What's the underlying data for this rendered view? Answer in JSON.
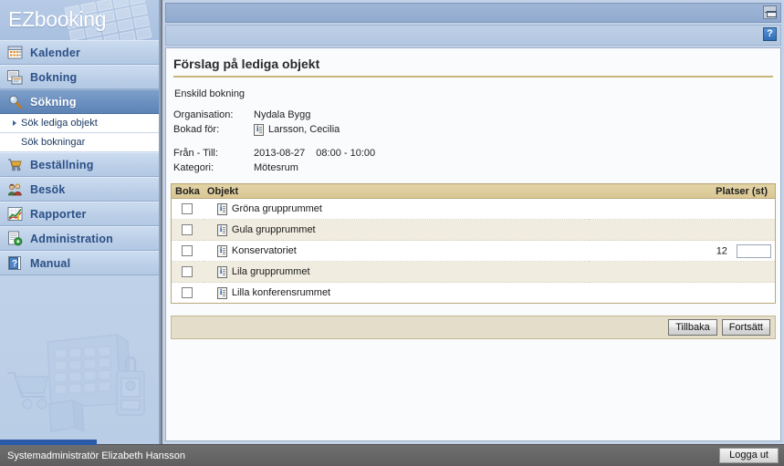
{
  "app": {
    "logo_text": "EZbooking"
  },
  "sidebar": {
    "items": [
      {
        "label": "Kalender",
        "icon": "calendar-icon",
        "selected": false
      },
      {
        "label": "Bokning",
        "icon": "booking-icon",
        "selected": false
      },
      {
        "label": "Sökning",
        "icon": "search-icon",
        "selected": true
      },
      {
        "label": "Beställning",
        "icon": "cart-icon",
        "selected": false
      },
      {
        "label": "Besök",
        "icon": "visitors-icon",
        "selected": false
      },
      {
        "label": "Rapporter",
        "icon": "chart-icon",
        "selected": false
      },
      {
        "label": "Administration",
        "icon": "admin-gear-icon",
        "selected": false
      },
      {
        "label": "Manual",
        "icon": "help-book-icon",
        "selected": false
      }
    ],
    "subitems": [
      {
        "label": "Sök lediga objekt",
        "active": true
      },
      {
        "label": "Sök bokningar",
        "active": false
      }
    ]
  },
  "toolbar": {
    "restore_icon": "restore-window-icon",
    "help_icon": "help-icon",
    "help_glyph": "?"
  },
  "main": {
    "page_title": "Förslag på lediga objekt",
    "booking_type": "Enskild bokning",
    "meta": [
      {
        "key": "Organisation:",
        "value": "Nydala Bygg",
        "has_icon": false
      },
      {
        "key": "Bokad för:",
        "value": "Larsson, Cecilia",
        "has_icon": true
      }
    ],
    "meta2": [
      {
        "key": "Från - Till:",
        "date": "2013-08-27",
        "time": "08:00 - 10:00"
      },
      {
        "key": "Kategori:",
        "date": "Mötesrum",
        "time": ""
      }
    ],
    "table": {
      "columns": [
        "Boka",
        "Objekt",
        "Platser (st)"
      ],
      "rows": [
        {
          "checked": false,
          "object": "Gröna grupprummet",
          "seats": "",
          "has_input": false
        },
        {
          "checked": false,
          "object": "Gula grupprummet",
          "seats": "",
          "has_input": false
        },
        {
          "checked": false,
          "object": "Konservatoriet",
          "seats": "12",
          "has_input": true,
          "input_value": ""
        },
        {
          "checked": false,
          "object": "Lila grupprummet",
          "seats": "",
          "has_input": false
        },
        {
          "checked": false,
          "object": "Lilla konferensrummet",
          "seats": "",
          "has_input": false
        }
      ]
    },
    "actions": {
      "back_label": "Tillbaka",
      "continue_label": "Fortsätt"
    }
  },
  "status": {
    "user_text": "Systemadministratör Elizabeth Hansson",
    "logout_label": "Logga ut"
  },
  "colors": {
    "sidebar_accent": "#2b4f86",
    "sidebar_selected": "#5d83b5",
    "table_header": "#d8c692",
    "table_border": "#b9a878",
    "row_alt": "#f0ece0",
    "title_rule": "#c9b47a"
  }
}
